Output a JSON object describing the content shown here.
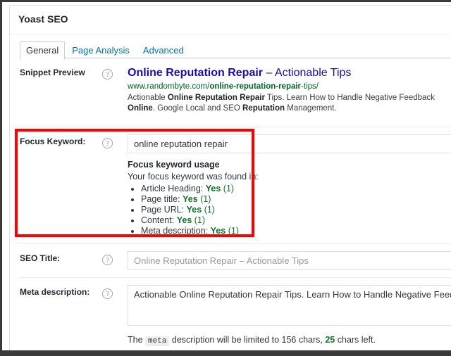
{
  "metabox": {
    "title": "Yoast SEO"
  },
  "tabs": [
    {
      "label": "General",
      "active": true
    },
    {
      "label": "Page Analysis",
      "active": false
    },
    {
      "label": "Advanced",
      "active": false
    }
  ],
  "help_icon": "?",
  "rows": {
    "snippet": {
      "label": "Snippet Preview",
      "title_bold": "Online Reputation Repair",
      "title_rest": " – Actionable Tips",
      "url_plain": "www.randombyte.com/",
      "url_bold": "online-reputation-repair",
      "url_tail": "-tips/",
      "desc_1": "Actionable ",
      "desc_2": "Online Reputation Repair",
      "desc_3": " Tips. Learn How to Handle Negative Feedback ",
      "desc_4": "Online",
      "desc_5": ". Google Local and SEO ",
      "desc_6": "Reputation",
      "desc_7": " Management."
    },
    "focus_keyword": {
      "label": "Focus Keyword:",
      "value": "online reputation repair",
      "placeholder": "",
      "usage_title": "Focus keyword usage",
      "usage_sub": "Your focus keyword was found in:",
      "items": [
        {
          "name": "Article Heading:",
          "yes": "Yes",
          "count": "(1)"
        },
        {
          "name": "Page title:",
          "yes": "Yes",
          "count": "(1)"
        },
        {
          "name": "Page URL:",
          "yes": "Yes",
          "count": "(1)"
        },
        {
          "name": "Content:",
          "yes": "Yes",
          "count": "(1)"
        },
        {
          "name": "Meta description:",
          "yes": "Yes",
          "count": "(1)"
        }
      ]
    },
    "seo_title": {
      "label": "SEO Title:",
      "value": "",
      "placeholder": "Online Reputation Repair – Actionable Tips"
    },
    "meta_description": {
      "label": "Meta description:",
      "value": "Actionable Online Reputation Repair Tips. Learn How to Handle Negative Feedback Online.",
      "placeholder": "",
      "note_1": "The ",
      "note_code": "meta",
      "note_2": " description will be limited to 156 chars, ",
      "note_chars_left": "25",
      "note_3": " chars left."
    }
  },
  "colors": {
    "link": "#0073aa",
    "snippet_title": "#1a0dab",
    "snippet_url": "#006621",
    "success_green": "#11742a",
    "annotation_red": "#fe0000"
  }
}
